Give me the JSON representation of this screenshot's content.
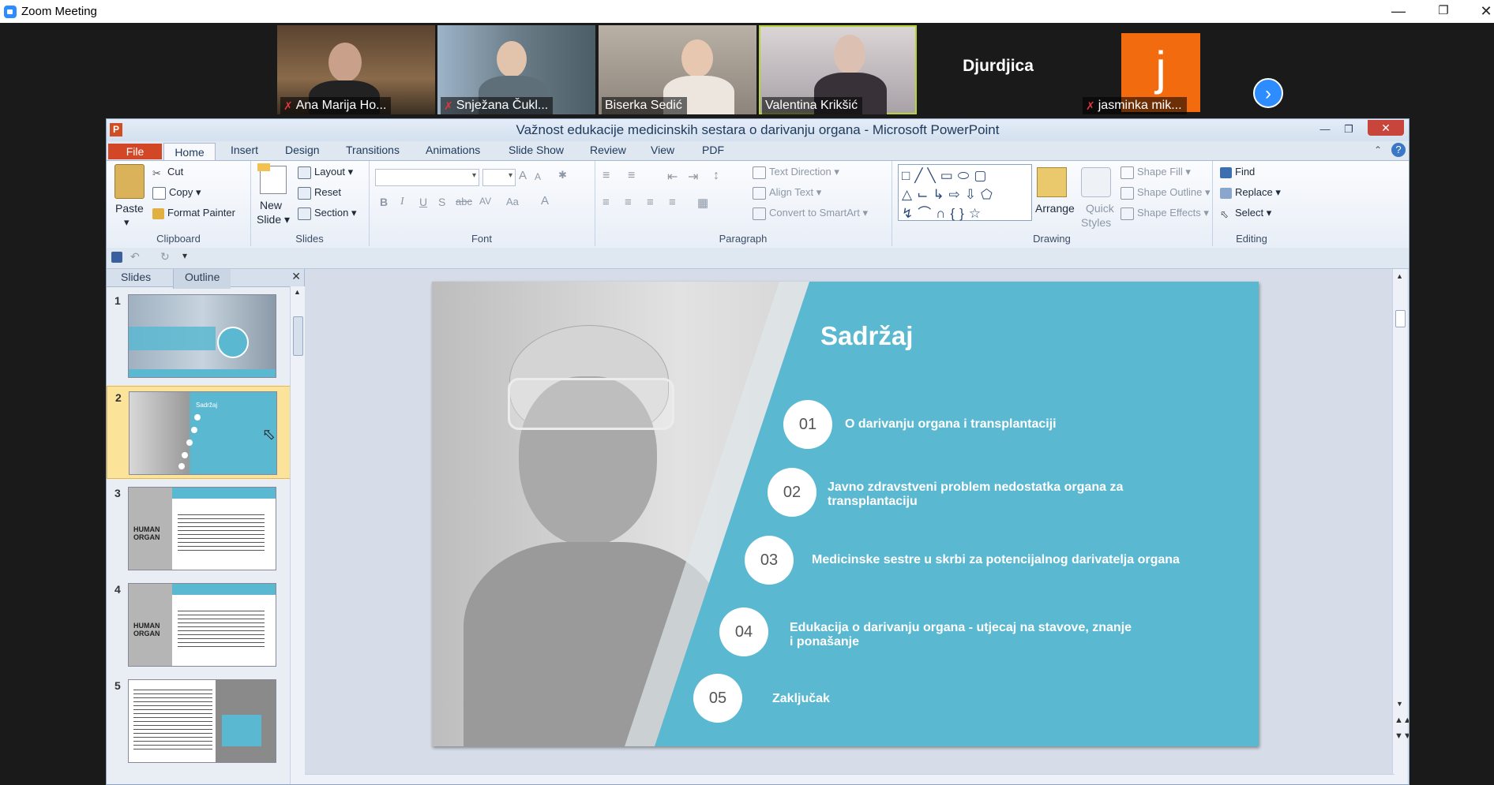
{
  "zoom": {
    "title": "Zoom Meeting",
    "controls": {
      "minimize": "—",
      "restore": "❐",
      "close": "✕"
    }
  },
  "participants": [
    {
      "name": "Ana Marija Ho...",
      "muted": true
    },
    {
      "name": "Snježana Čukl...",
      "muted": true
    },
    {
      "name": "Biserka Sedić",
      "muted": false
    },
    {
      "name": "Valentina Krikšić",
      "muted": false,
      "active": true
    },
    {
      "name": "Djurdjica",
      "muted": false,
      "video": false
    },
    {
      "name": "jasminka mik...",
      "muted": true,
      "avatar_letter": "j",
      "avatar_color": "#f26c0f"
    }
  ],
  "next_page_icon": "›",
  "ppt": {
    "title": "Važnost edukacije medicinskih sestara o darivanju organa  -  Microsoft PowerPoint",
    "icon_letter": "P",
    "tabs": [
      "File",
      "Home",
      "Insert",
      "Design",
      "Transitions",
      "Animations",
      "Slide Show",
      "Review",
      "View",
      "PDF"
    ],
    "ribbon": {
      "clipboard": {
        "paste": "Paste",
        "cut": "Cut",
        "copy": "Copy",
        "format_painter": "Format Painter",
        "label": "Clipboard"
      },
      "slides": {
        "new_slide": "New",
        "new_slide2": "Slide",
        "layout": "Layout",
        "reset": "Reset",
        "section": "Section",
        "label": "Slides"
      },
      "font": {
        "label": "Font",
        "bold": "B",
        "italic": "I",
        "underline": "U",
        "shadow": "S",
        "strike": "abc",
        "spacing": "AV",
        "case": "Aa",
        "color": "A",
        "grow": "A",
        "shrink": "A"
      },
      "paragraph": {
        "label": "Paragraph",
        "text_direction": "Text Direction",
        "align_text": "Align Text",
        "convert": "Convert to SmartArt"
      },
      "drawing": {
        "label": "Drawing",
        "arrange": "Arrange",
        "quick": "Quick",
        "styles": "Styles",
        "shape_fill": "Shape Fill",
        "shape_outline": "Shape Outline",
        "shape_effects": "Shape Effects"
      },
      "editing": {
        "label": "Editing",
        "find": "Find",
        "replace": "Replace",
        "select": "Select"
      }
    },
    "pane_tabs": {
      "slides": "Slides",
      "outline": "Outline"
    },
    "thumbnails": [
      "1",
      "2",
      "3",
      "4",
      "5"
    ],
    "thumb_text": {
      "t2_title": "Sadržaj",
      "human": "HUMAN",
      "organ": "ORGAN"
    }
  },
  "slide": {
    "title": "Sadržaj",
    "items": [
      {
        "num": "01",
        "text": "O darivanju organa i transplantaciji"
      },
      {
        "num": "02",
        "text": "Javno zdravstveni problem nedostatka organa za transplantaciju"
      },
      {
        "num": "03",
        "text": "Medicinske sestre u skrbi za potencijalnog darivatelja organa"
      },
      {
        "num": "04",
        "text": "Edukacija o darivanju organa -  utjecaj na stavove, znanje i ponašanje"
      },
      {
        "num": "05",
        "text": "Zaključak"
      }
    ],
    "accent": "#5bb8d1"
  }
}
